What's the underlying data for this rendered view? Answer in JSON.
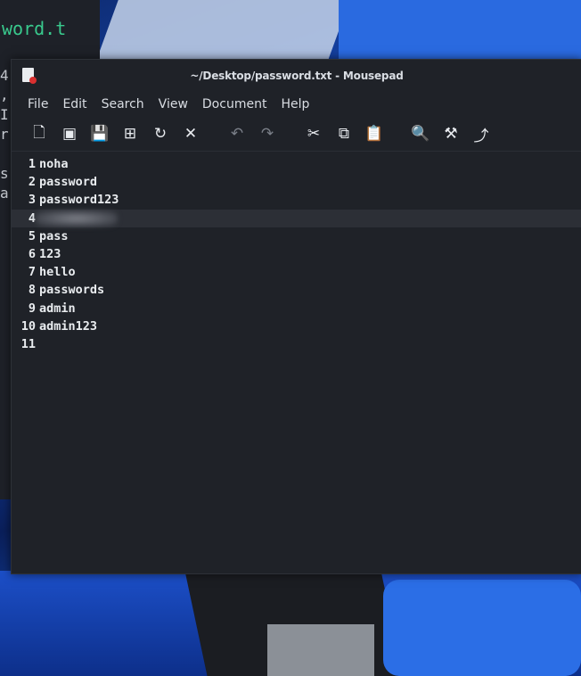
{
  "background_terminal": {
    "text": "word.t",
    "side_chars": [
      "4",
      ",",
      "I",
      "r",
      "",
      "s",
      "a"
    ]
  },
  "window": {
    "title": "~/Desktop/password.txt - Mousepad"
  },
  "menu": [
    "File",
    "Edit",
    "Search",
    "View",
    "Document",
    "Help"
  ],
  "toolbar": [
    {
      "icon": "new-document-icon",
      "glyph": "🗋",
      "enabled": true
    },
    {
      "icon": "new-window-icon",
      "glyph": "▣",
      "enabled": true
    },
    {
      "icon": "save-icon",
      "glyph": "💾",
      "enabled": false
    },
    {
      "icon": "save-as-icon",
      "glyph": "⊞",
      "enabled": true
    },
    {
      "icon": "reload-icon",
      "glyph": "↻",
      "enabled": true
    },
    {
      "icon": "close-icon",
      "glyph": "✕",
      "enabled": true
    },
    {
      "icon": "undo-icon",
      "glyph": "↶",
      "enabled": false
    },
    {
      "icon": "redo-icon",
      "glyph": "↷",
      "enabled": false
    },
    {
      "icon": "cut-icon",
      "glyph": "✂",
      "enabled": true
    },
    {
      "icon": "copy-icon",
      "glyph": "⧉",
      "enabled": true
    },
    {
      "icon": "paste-icon",
      "glyph": "📋",
      "enabled": true
    },
    {
      "icon": "find-icon",
      "glyph": "🔍",
      "enabled": true
    },
    {
      "icon": "find-replace-icon",
      "glyph": "⚒",
      "enabled": true
    },
    {
      "icon": "go-to-line-icon",
      "glyph": "⤴",
      "enabled": true
    }
  ],
  "lines": [
    {
      "n": "1",
      "text": "noha"
    },
    {
      "n": "2",
      "text": "password"
    },
    {
      "n": "3",
      "text": "password123"
    },
    {
      "n": "4",
      "text": "",
      "redacted": true,
      "current": true
    },
    {
      "n": "5",
      "text": "pass"
    },
    {
      "n": "6",
      "text": "123"
    },
    {
      "n": "7",
      "text": "hello"
    },
    {
      "n": "8",
      "text": "passwords"
    },
    {
      "n": "9",
      "text": "admin"
    },
    {
      "n": "10",
      "text": "admin123"
    },
    {
      "n": "11",
      "text": ""
    }
  ],
  "colors": {
    "editor_bg": "#1f2228",
    "terminal_green": "#39c98d"
  }
}
